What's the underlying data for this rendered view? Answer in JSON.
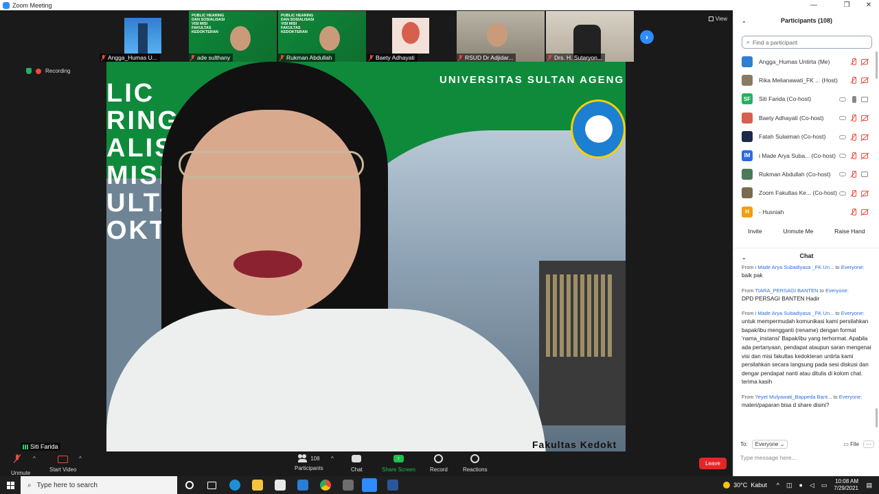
{
  "window": {
    "title": "Zoom Meeting"
  },
  "thumbnails": [
    {
      "name": "Angga_Humas U...",
      "style": "tower"
    },
    {
      "name": "ade sulthany",
      "style": "green"
    },
    {
      "name": "Rukman Abdullah",
      "style": "green"
    },
    {
      "name": "Baety Adhayati",
      "style": "baety"
    },
    {
      "name": "RSUD Dr Adjidar...",
      "style": "rsud"
    },
    {
      "name": "Drs. H. Sutaryon...",
      "style": "drs"
    }
  ],
  "thumb_banner_text": "PUBLIC HEARING DAN SOSIALISASI VISI MISI FAKULTAS KEDOKTERAN",
  "view_label": "View",
  "recording_label": "Recording",
  "speaker": {
    "name": "Siti Farida",
    "slide_university": "UNIVERSITAS SULTAN AGENG",
    "slide_big_text": "LIC\nRING\nALIS\nMISI\nULTAS\nOKTER",
    "slide_footer": "Fakultas Kedokt"
  },
  "toolbar": {
    "unmute": "Unmute",
    "start_video": "Start Video",
    "participants": "Participants",
    "participants_count": "108",
    "chat": "Chat",
    "share_screen": "Share Screen",
    "record": "Record",
    "reactions": "Reactions",
    "leave": "Leave"
  },
  "participants_panel": {
    "title": "Participants (108)",
    "search_placeholder": "Find a participant",
    "list": [
      {
        "name": "Angga_Humas Untirta (Me)",
        "avatar_bg": "#2f7fd0",
        "initials": "",
        "mic": "muted",
        "video": "off",
        "cloud": false
      },
      {
        "name": "Rika Melianawati_FK ... (Host)",
        "avatar_bg": "#8a7a60",
        "initials": "",
        "mic": "muted",
        "video": "off",
        "cloud": false
      },
      {
        "name": "Siti Farida (Co-host)",
        "avatar_bg": "#27ae60",
        "initials": "SF",
        "mic": "on",
        "video": "on",
        "cloud": true
      },
      {
        "name": "Baety Adhayati (Co-host)",
        "avatar_bg": "#d6604d",
        "initials": "",
        "mic": "muted",
        "video": "off",
        "cloud": true
      },
      {
        "name": "Fatah Sulaiman (Co-host)",
        "avatar_bg": "#1b2a4a",
        "initials": "",
        "mic": "muted",
        "video": "off",
        "cloud": true
      },
      {
        "name": "i Made Arya Suba... (Co-host)",
        "avatar_bg": "#2d6cdf",
        "initials": "IM",
        "mic": "muted",
        "video": "off",
        "cloud": true
      },
      {
        "name": "Rukman Abdullah (Co-host)",
        "avatar_bg": "#4a7a5a",
        "initials": "",
        "mic": "muted",
        "video": "on",
        "cloud": true
      },
      {
        "name": "Zoom Fakultas Ke... (Co-host)",
        "avatar_bg": "#7a6a50",
        "initials": "",
        "mic": "muted",
        "video": "off",
        "cloud": true
      },
      {
        "name": "- Husniah",
        "avatar_bg": "#f39c12",
        "initials": "H",
        "mic": "muted",
        "video": "off",
        "cloud": false
      }
    ],
    "buttons": {
      "invite": "Invite",
      "unmute_me": "Unmute Me",
      "raise_hand": "Raise Hand"
    }
  },
  "chat": {
    "title": "Chat",
    "messages": [
      {
        "from_label": "From",
        "sender": "i Made Arya Subadiyasa _FK Un...",
        "to_label": "to",
        "recipient": "Everyone:",
        "body": "baik pak"
      },
      {
        "from_label": "From",
        "sender": "TIARA_PERSAGI BANTEN",
        "to_label": "to",
        "recipient": "Everyone:",
        "body": "DPD PERSAGI BANTEN Hadir"
      },
      {
        "from_label": "From",
        "sender": "i Made Arya Subadiyasa _FK Un...",
        "to_label": "to",
        "recipient": "Everyone:",
        "body": "untuk mempermudah komunikasi kami persilahkan bapak/ibu mengganti (rename) dengan format 'nama_instansi' Bapak/ibu yang terhormat. Apabila ada pertanyaan, pendapat ataupun saran mengenai visi dan misi fakultas kedokteran untirta kami persilahkan secara langsung pada sesi diskusi dan dengar pendapat nanti atau ditulis di kolom chat. terima kasih"
      },
      {
        "from_label": "From",
        "sender": "Yeyet Mulyawati_Bappeda Bant...",
        "to_label": "to",
        "recipient": "Everyone:",
        "body": "materi/paparan bisa d share disini?"
      }
    ],
    "to_label": "To:",
    "to_value": "Everyone",
    "file_label": "File",
    "input_placeholder": "Type message here..."
  },
  "taskbar": {
    "search_placeholder": "Type here to search",
    "weather": "30°C  Kabut",
    "time": "10:08 AM",
    "date": "7/29/2021"
  },
  "colors": {
    "zoom_blue": "#2d8cff",
    "leave_red": "#e02828",
    "share_green": "#1fbf52",
    "muted_red": "#e74c3c"
  }
}
